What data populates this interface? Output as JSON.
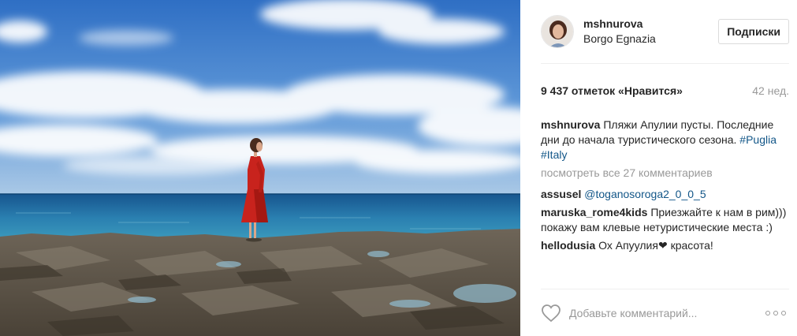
{
  "header": {
    "username": "mshnurova",
    "location": "Borgo Egnazia",
    "follow_label": "Подписки"
  },
  "stats": {
    "likes": "9 437 отметок «Нравится»",
    "ago": "42 нед."
  },
  "caption": {
    "user": "mshnurova",
    "text": "Пляжи Апулии пусты. Последние дни до начала туристического сезона.",
    "tag1": "#Puglia",
    "tag2": "#Italy"
  },
  "view_all": "посмотреть все 27 комментариев",
  "comments": [
    {
      "user": "assusel",
      "text": "@toganosoroga2_0_0_5"
    },
    {
      "user": "maruska_rome4kids",
      "text": "Приезжайте к нам в рим))) покажу вам клевые нетуристические места :)"
    },
    {
      "user": "hellodusia",
      "text": "Ох Апуулия",
      "heart": "❤",
      "text2": "красота!"
    }
  ],
  "add_comment": {
    "placeholder": "Добавьте комментарий..."
  },
  "icons": {
    "like": "heart-outline-icon",
    "options": "more-options-icon"
  },
  "colors": {
    "sky": "#3f7fd0",
    "sea": "#1f6fa8",
    "dress": "#c8231d",
    "hashtag": "#125688",
    "muted": "#999999"
  }
}
